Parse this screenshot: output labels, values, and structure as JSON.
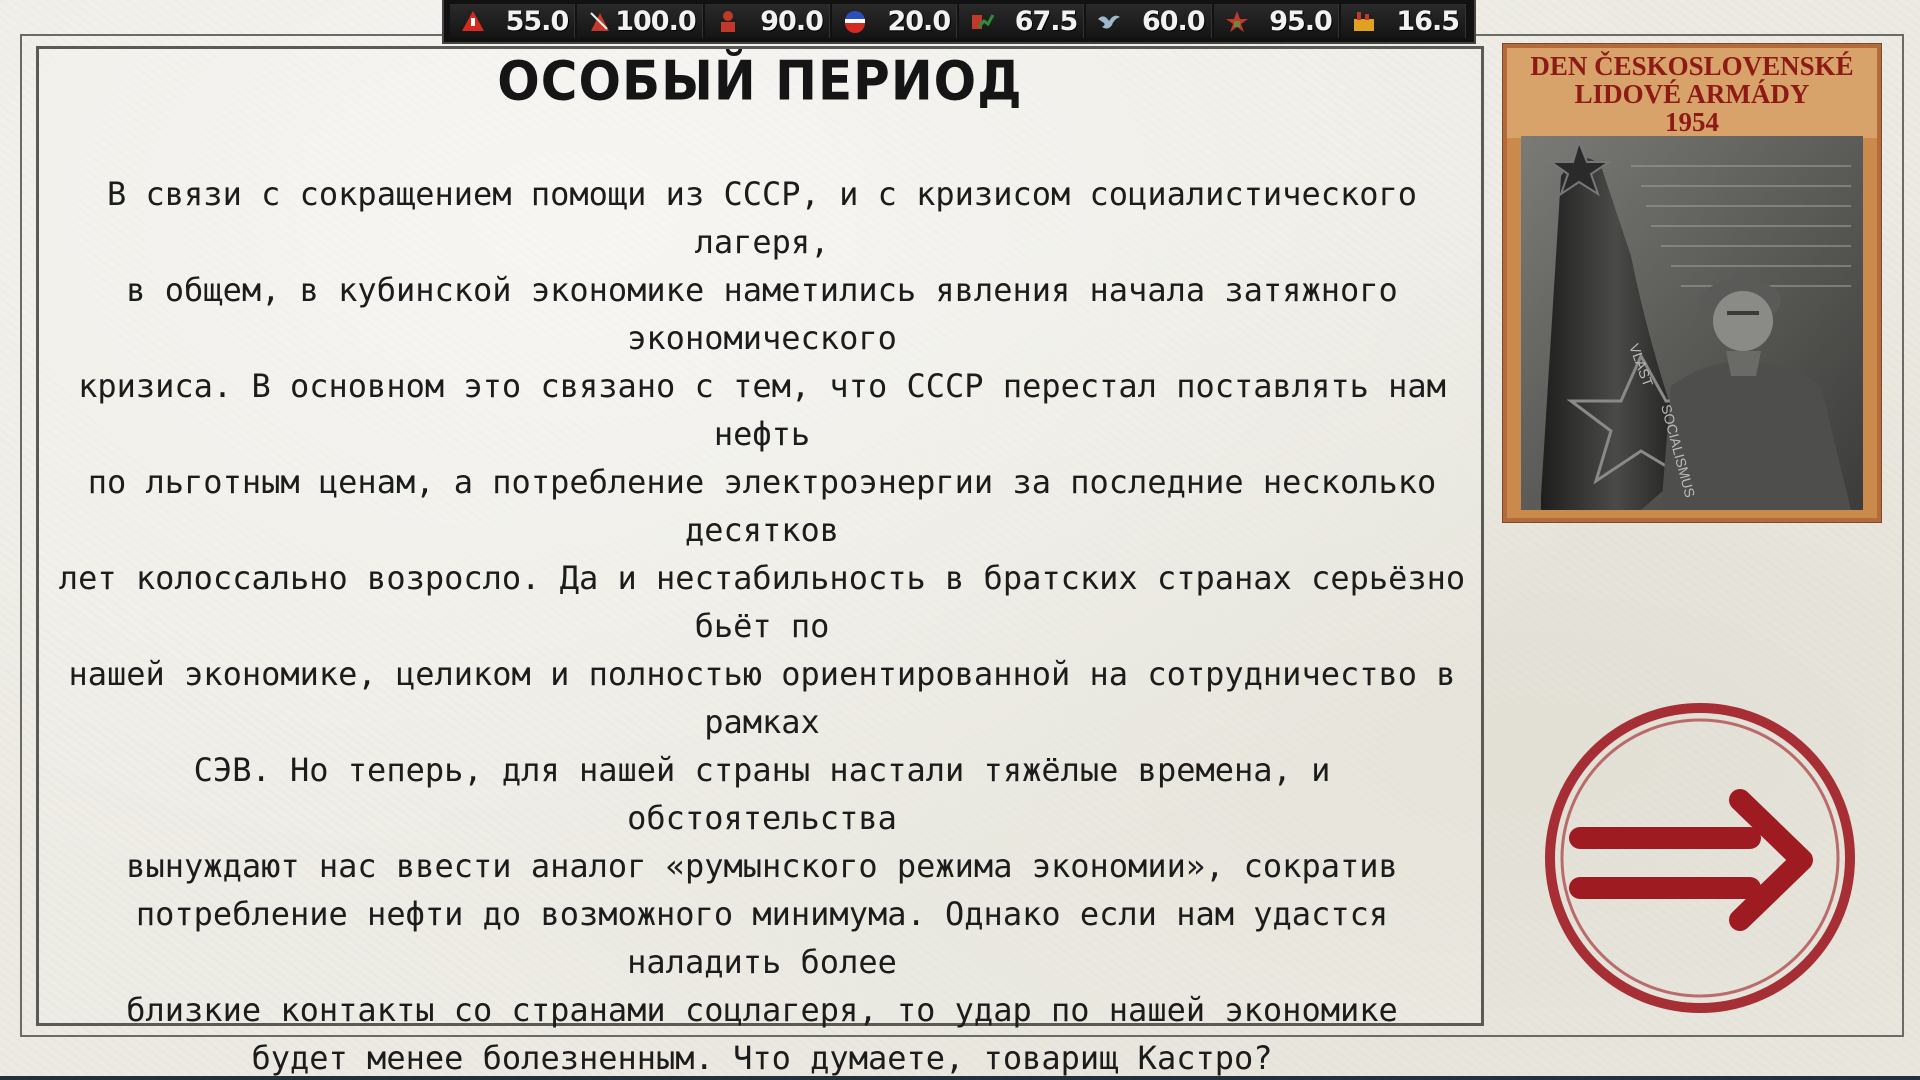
{
  "topbar": {
    "stats": [
      {
        "icon": "stability-icon",
        "value": "55.0",
        "color": "#d42a20"
      },
      {
        "icon": "war-support-icon",
        "value": "100.0",
        "color": "#c23a2a"
      },
      {
        "icon": "manpower-icon",
        "value": "90.0",
        "color": "#c0392b"
      },
      {
        "icon": "political-power-icon",
        "value": "20.0",
        "color": "#2b4fbf"
      },
      {
        "icon": "economy-icon",
        "value": "67.5",
        "color": "#2e8b3a"
      },
      {
        "icon": "bird-icon",
        "value": "60.0",
        "color": "#9fb8cc"
      },
      {
        "icon": "army-icon",
        "value": "95.0",
        "color": "#c0392b"
      },
      {
        "icon": "industry-icon",
        "value": "16.5",
        "color": "#e0a020"
      }
    ]
  },
  "event": {
    "title": "ОСОБЫЙ ПЕРИОД",
    "body_lines": [
      "В связи с сокращением помощи из СССР, и с кризисом социалистического лагеря,",
      "в общем, в кубинской экономике наметились явления начала затяжного экономического",
      "кризиса. В основном это связано с тем, что СССР перестал поставлять нам нефть",
      "по льготным ценам, а потребление электроэнергии за последние несколько десятков",
      "лет колоссально возросло. Да и нестабильность в братских странах серьёзно бьёт по",
      "нашей экономике, целиком и полностью ориентированной на сотрудничество в рамках",
      "СЭВ. Но теперь, для нашей страны настали тяжёлые времена, и обстоятельства",
      "вынуждают нас ввести аналог «румынского режима экономии», сократив",
      "потребление нефти до возможного минимума. Однако если нам удастся наладить более",
      "близкие контакты со странами соцлагеря, то удар по нашей экономике",
      "будет менее болезненным. Что думаете, товарищ Кастро?"
    ]
  },
  "picture": {
    "line1": "DEN ČESKOSLOVENSKÉ",
    "line2": "LIDOVÉ ARMÁDY",
    "line3": "1954",
    "banner_text_1": "VLAST",
    "banner_text_2": "SOCIALISMUS"
  },
  "continue": {
    "icon": "arrow-right-icon",
    "color": "#9e1b22"
  }
}
